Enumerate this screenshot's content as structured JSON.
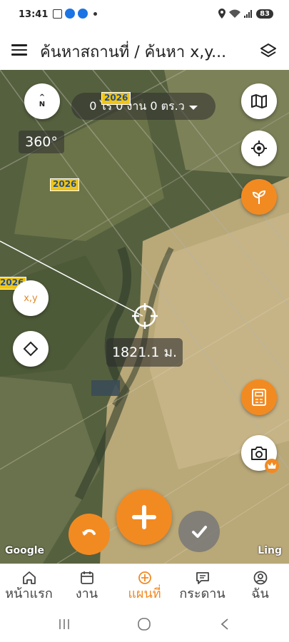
{
  "status_bar": {
    "time": "13:41",
    "battery": "83"
  },
  "header": {
    "title": "ค้นหาสถานที่ / ค้นหา x,y..."
  },
  "map": {
    "area_text": "0 ไร่ 0 งาน 0 ตร.ว",
    "heading": "360°",
    "compass": {
      "top": "^",
      "bottom": "N"
    },
    "road_labels": [
      "2026",
      "2026",
      "2026",
      "2026"
    ],
    "distance": "1821.1 ม.",
    "xy_button_label": "x,y",
    "google_logo": "Google",
    "ling_logo": "Ling"
  },
  "nav": {
    "items": [
      {
        "label": "หน้าแรก",
        "icon": "home-icon",
        "active": false
      },
      {
        "label": "งาน",
        "icon": "calendar-icon",
        "active": false
      },
      {
        "label": "แผนที่",
        "icon": "target-icon",
        "active": true
      },
      {
        "label": "กระดาน",
        "icon": "message-icon",
        "active": false
      },
      {
        "label": "ฉัน",
        "icon": "user-icon",
        "active": false
      }
    ]
  },
  "colors": {
    "accent": "#f28a22",
    "road_label_bg": "#f0c515",
    "road_label_text": "#1d4e9a"
  }
}
